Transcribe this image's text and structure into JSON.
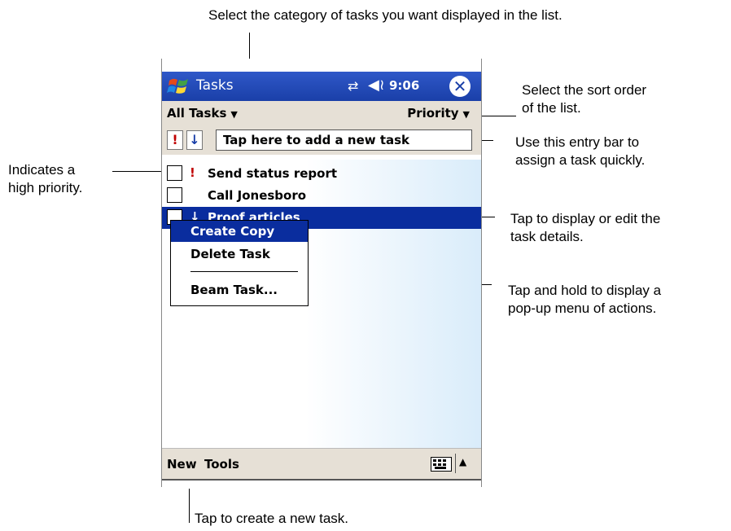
{
  "callouts": {
    "category": "Select the category of tasks you want displayed in the list.",
    "sort_line1": "Select the sort order",
    "sort_line2": "of the list.",
    "entry_line1": "Use this entry bar to",
    "entry_line2": "assign a task quickly.",
    "priority_line1": "Indicates a",
    "priority_line2": "high priority.",
    "details_line1": "Tap to display or edit the",
    "details_line2": "task details.",
    "hold_line1": "Tap and hold to display a",
    "hold_line2": "pop-up menu of actions.",
    "new_task": "Tap to create a new task."
  },
  "titlebar": {
    "title": "Tasks",
    "time": "9:06",
    "icons": [
      "windows-logo-icon",
      "sync-icon",
      "volume-icon",
      "close-icon"
    ],
    "color": "#1a3fa8"
  },
  "toolbar": {
    "category": "All Tasks",
    "sort": "Priority"
  },
  "entry_bar": {
    "high_priority_symbol": "!",
    "low_priority_symbol": "↓",
    "placeholder": "Tap here to add a new task"
  },
  "tasks": [
    {
      "priority_symbol": "!",
      "label": "Send status report",
      "selected": false
    },
    {
      "priority_symbol": "",
      "label": "Call Jonesboro",
      "selected": false
    },
    {
      "priority_symbol": "↓",
      "label": "Proof articles",
      "selected": true
    }
  ],
  "context_menu": {
    "items": [
      "Create Copy",
      "Delete Task",
      "Beam Task..."
    ]
  },
  "bottom_bar": {
    "new": "New",
    "tools": "Tools"
  },
  "colors": {
    "selection": "#0a2d9e",
    "priority_high": "#c00000",
    "priority_low": "#1a3fa8"
  }
}
